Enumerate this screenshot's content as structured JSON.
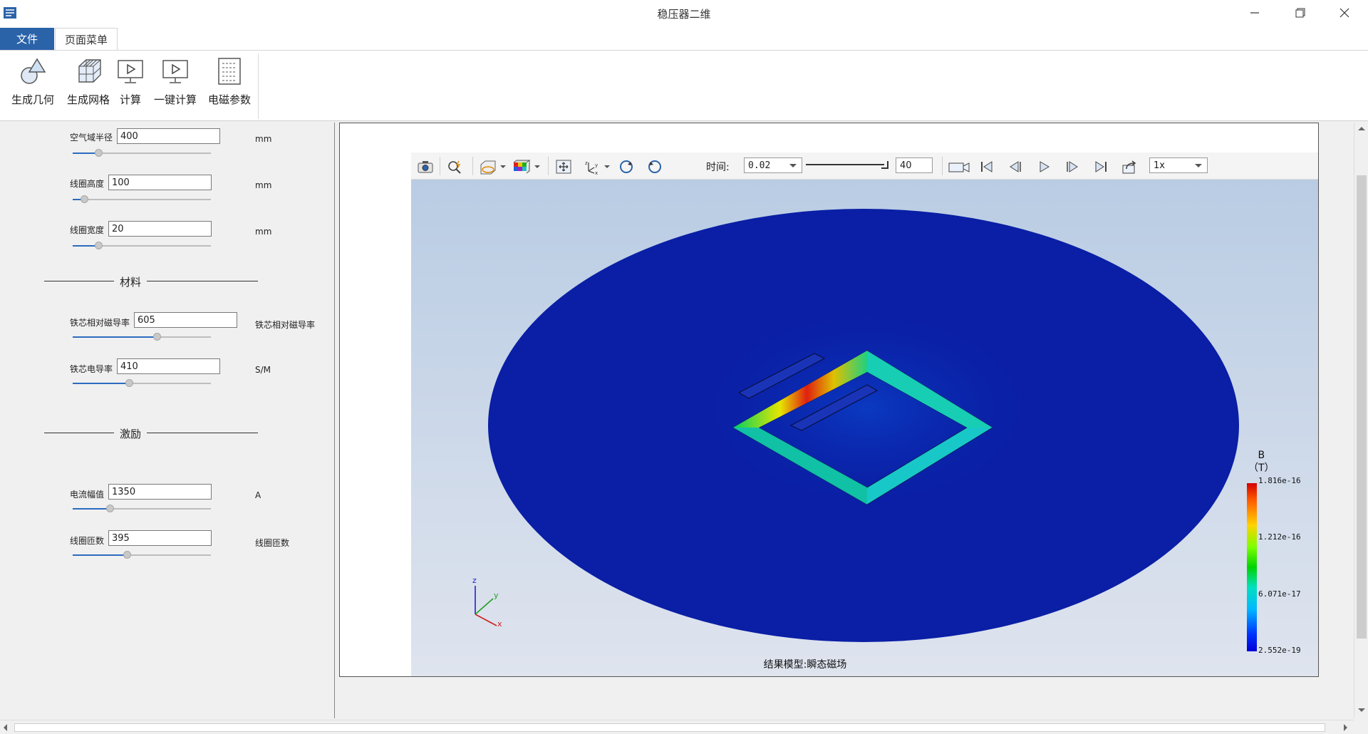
{
  "window": {
    "title": "稳压器二维"
  },
  "menu": {
    "tabs": [
      {
        "label": "文件",
        "active": true
      },
      {
        "label": "页面菜单"
      }
    ]
  },
  "ribbon": {
    "buttons": [
      {
        "label": "生成几何",
        "icon": "geometry-icon"
      },
      {
        "label": "生成网格",
        "icon": "mesh-icon"
      },
      {
        "label": "计算",
        "icon": "compute-icon"
      },
      {
        "label": "一键计算",
        "icon": "one-click-compute-icon"
      },
      {
        "label": "电磁参数",
        "icon": "em-params-icon"
      }
    ]
  },
  "params": {
    "air_radius": {
      "label": "空气域半径",
      "value": "400",
      "unit": "mm"
    },
    "coil_height": {
      "label": "线圈高度",
      "value": "100",
      "unit": "mm"
    },
    "coil_width": {
      "label": "线圈宽度",
      "value": "20",
      "unit": "mm"
    },
    "material_title": "材料",
    "core_permeability": {
      "label": "铁芯相对磁导率",
      "value": "605",
      "unit": "铁芯相对磁导率"
    },
    "core_conductivity": {
      "label": "铁芯电导率",
      "value": "410",
      "unit": "S/M"
    },
    "excitation_title": "激励",
    "current_amp": {
      "label": "电流幅值",
      "value": "1350",
      "unit": "A"
    },
    "coil_turns": {
      "label": "线圈匝数",
      "value": "395",
      "unit": "线圈匝数"
    }
  },
  "viewer": {
    "time_label": "时间:",
    "time_value": "0.02",
    "frame_value": "40",
    "speed_value": "1x",
    "caption": "结果模型:瞬态磁场",
    "axes": {
      "x": "x",
      "y": "y",
      "z": "z"
    },
    "legend": {
      "quantity": "B",
      "unit": "（T）",
      "ticks": [
        "1.816e-16",
        "1.212e-16",
        "6.071e-17",
        "2.552e-19"
      ],
      "colors": {
        "high": "#d40000",
        "mid": "#00d400",
        "low": "#0000d8"
      }
    }
  }
}
